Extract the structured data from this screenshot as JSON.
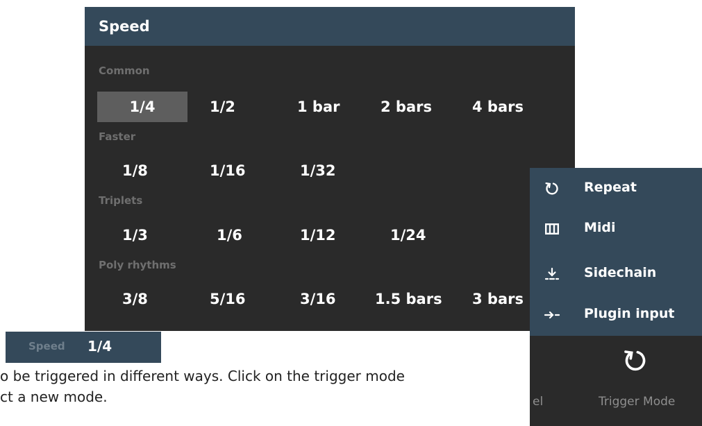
{
  "speed_panel": {
    "title": "Speed",
    "categories": [
      {
        "label": "Common",
        "options": [
          "1/4",
          "1/2",
          "1 bar",
          "2 bars",
          "4 bars"
        ]
      },
      {
        "label": "Faster",
        "options": [
          "1/8",
          "1/16",
          "1/32"
        ]
      },
      {
        "label": "Triplets",
        "options": [
          "1/3",
          "1/6",
          "1/12",
          "1/24"
        ]
      },
      {
        "label": "Poly rhythms",
        "options": [
          "3/8",
          "5/16",
          "3/16",
          "1.5 bars",
          "3 bars"
        ]
      }
    ],
    "selected": "1/4"
  },
  "mini_speed": {
    "label": "Speed",
    "value": "1/4"
  },
  "body_text": {
    "line1": "o be triggered in different ways. Click on the trigger mode",
    "line2": "ct a new mode."
  },
  "trigger_menu": {
    "items": [
      {
        "icon": "repeat-icon",
        "label": "Repeat"
      },
      {
        "icon": "piano-keys-icon",
        "label": "Midi"
      },
      {
        "icon": "sidechain-icon",
        "label": "Sidechain"
      },
      {
        "icon": "plugin-input-icon",
        "label": "Plugin input"
      }
    ],
    "partial_label": "el",
    "mode_label": "Trigger Mode",
    "current_icon": "repeat-icon"
  }
}
